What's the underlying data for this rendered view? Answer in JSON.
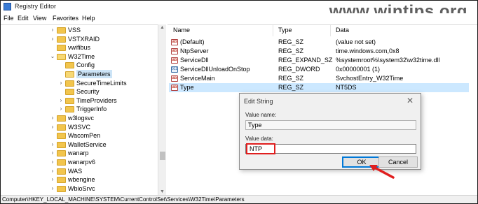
{
  "window": {
    "title": "Registry Editor"
  },
  "watermark": "www.wintips.org",
  "menu": [
    "File",
    "Edit",
    "View",
    "Favorites",
    "Help"
  ],
  "tree": [
    {
      "label": "VSS",
      "chev": ">",
      "depth": 0,
      "open": false,
      "selected": false
    },
    {
      "label": "VSTXRAID",
      "chev": ">",
      "depth": 0,
      "open": false,
      "selected": false
    },
    {
      "label": "vwifibus",
      "chev": "",
      "depth": 0,
      "open": false,
      "selected": false
    },
    {
      "label": "W32Time",
      "chev": "v",
      "depth": 0,
      "open": true,
      "selected": false
    },
    {
      "label": "Config",
      "chev": "",
      "depth": 1,
      "open": false,
      "selected": false
    },
    {
      "label": "Parameters",
      "chev": "",
      "depth": 1,
      "open": true,
      "selected": true
    },
    {
      "label": "SecureTimeLimits",
      "chev": ">",
      "depth": 1,
      "open": false,
      "selected": false
    },
    {
      "label": "Security",
      "chev": "",
      "depth": 1,
      "open": false,
      "selected": false
    },
    {
      "label": "TimeProviders",
      "chev": ">",
      "depth": 1,
      "open": false,
      "selected": false
    },
    {
      "label": "TriggerInfo",
      "chev": ">",
      "depth": 1,
      "open": false,
      "selected": false
    },
    {
      "label": "w3logsvc",
      "chev": ">",
      "depth": 0,
      "open": false,
      "selected": false
    },
    {
      "label": "W3SVC",
      "chev": ">",
      "depth": 0,
      "open": false,
      "selected": false
    },
    {
      "label": "WacomPen",
      "chev": "",
      "depth": 0,
      "open": false,
      "selected": false
    },
    {
      "label": "WalletService",
      "chev": ">",
      "depth": 0,
      "open": false,
      "selected": false
    },
    {
      "label": "wanarp",
      "chev": ">",
      "depth": 0,
      "open": false,
      "selected": false
    },
    {
      "label": "wanarpv6",
      "chev": ">",
      "depth": 0,
      "open": false,
      "selected": false
    },
    {
      "label": "WAS",
      "chev": ">",
      "depth": 0,
      "open": false,
      "selected": false
    },
    {
      "label": "wbengine",
      "chev": ">",
      "depth": 0,
      "open": false,
      "selected": false
    },
    {
      "label": "WbioSrvc",
      "chev": ">",
      "depth": 0,
      "open": false,
      "selected": false
    }
  ],
  "columns": {
    "name": "Name",
    "type": "Type",
    "data": "Data"
  },
  "values": [
    {
      "name": "(Default)",
      "type": "REG_SZ",
      "data": "(value not set)",
      "icon": "string-value-icon",
      "selected": false
    },
    {
      "name": "NtpServer",
      "type": "REG_SZ",
      "data": "time.windows.com,0x8",
      "icon": "string-value-icon",
      "selected": false
    },
    {
      "name": "ServiceDll",
      "type": "REG_EXPAND_SZ",
      "data": "%systemroot%\\system32\\w32time.dll",
      "icon": "string-value-icon",
      "selected": false
    },
    {
      "name": "ServiceDllUnloadOnStop",
      "type": "REG_DWORD",
      "data": "0x00000001 (1)",
      "icon": "binary-value-icon",
      "selected": false
    },
    {
      "name": "ServiceMain",
      "type": "REG_SZ",
      "data": "SvchostEntry_W32Time",
      "icon": "string-value-icon",
      "selected": false
    },
    {
      "name": "Type",
      "type": "REG_SZ",
      "data": "NT5DS",
      "icon": "string-value-icon",
      "selected": true
    }
  ],
  "dialog": {
    "title": "Edit String",
    "value_name_label": "Value name:",
    "value_name": "Type",
    "value_data_label": "Value data:",
    "value_data": "NTP",
    "ok_label": "OK",
    "cancel_label": "Cancel"
  },
  "status_path": "Computer\\HKEY_LOCAL_MACHINE\\SYSTEM\\CurrentControlSet\\Services\\W32Time\\Parameters",
  "colors": {
    "selection": "#cce8ff",
    "highlight_box": "#e01e1e",
    "arrow": "#e01e1e",
    "folder": "#f2c54d"
  }
}
